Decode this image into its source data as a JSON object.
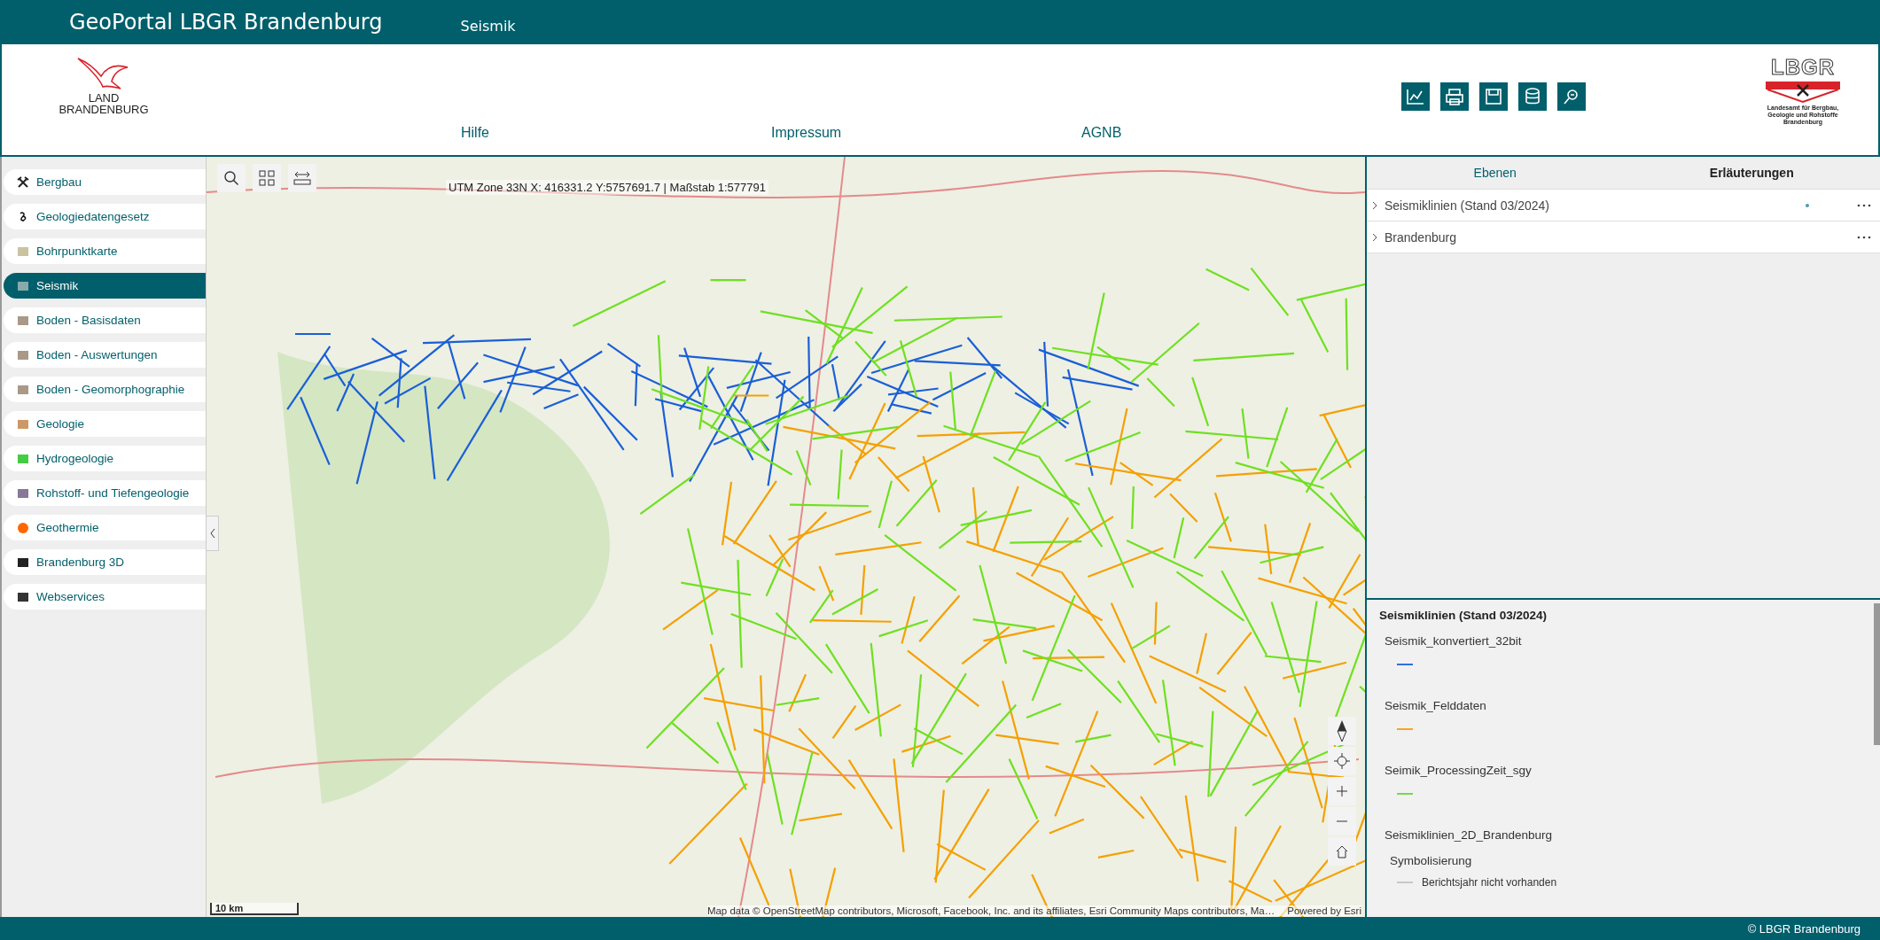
{
  "topbar": {
    "title": "GeoPortal LBGR Brandenburg",
    "section": "Seismik"
  },
  "header": {
    "state_logo": [
      "LAND",
      "BRANDENBURG"
    ],
    "nav": [
      "Hilfe",
      "Impressum",
      "AGNB"
    ],
    "agency_logo": {
      "acronym": "LBGR",
      "name": "Landesamt für Bergbau, Geologie und Rohstoffe Brandenburg"
    }
  },
  "sidebar": {
    "items": [
      {
        "label": "Bergbau",
        "selected": false
      },
      {
        "label": "Geologiedatengesetz",
        "selected": false
      },
      {
        "label": "Bohrpunktkarte",
        "selected": false
      },
      {
        "label": "Seismik",
        "selected": true
      },
      {
        "label": "Boden - Basisdaten",
        "selected": false
      },
      {
        "label": "Boden - Auswertungen",
        "selected": false
      },
      {
        "label": "Boden - Geomorphographie",
        "selected": false
      },
      {
        "label": "Geologie",
        "selected": false
      },
      {
        "label": "Hydrogeologie",
        "selected": false
      },
      {
        "label": "Rohstoff- und Tiefengeologie",
        "selected": false
      },
      {
        "label": "Geothermie",
        "selected": false
      },
      {
        "label": "Brandenburg 3D",
        "selected": false
      },
      {
        "label": "Webservices",
        "selected": false
      }
    ]
  },
  "map": {
    "coordinates": "UTM Zone 33N X: 416331.2 Y:5757691.7 | Maßstab 1:577791",
    "scale": "10 km",
    "attribution": "Map data © OpenStreetMap contributors, Microsoft, Facebook, Inc. and its affiliates, Esri Community Maps contributors, Ma…",
    "powered_by": "Powered by Esri"
  },
  "panel": {
    "tabs": [
      {
        "label": "Ebenen",
        "selected": false
      },
      {
        "label": "Erläuterungen",
        "selected": true
      }
    ],
    "layers": [
      {
        "name": "Seismiklinien (Stand 03/2024)",
        "indicator": true
      },
      {
        "name": "Brandenburg",
        "indicator": false
      }
    ],
    "legend": {
      "title": "Seismiklinien (Stand 03/2024)",
      "entries": [
        {
          "kind": "layer",
          "label": "Seismik_konvertiert_32bit",
          "color": "#2f6fe0"
        },
        {
          "kind": "layer",
          "label": "Seismik_Felddaten",
          "color": "#f5a623"
        },
        {
          "kind": "layer",
          "label": "Seimik_ProcessingZeit_sgy",
          "color": "#77d94a"
        },
        {
          "kind": "heading",
          "label": "Seismiklinien_2D_Brandenburg"
        },
        {
          "kind": "subheading",
          "label": "Symbolisierung"
        },
        {
          "kind": "class",
          "label": "Berichtsjahr nicht vorhanden",
          "color": "#c8c8c8"
        }
      ]
    }
  },
  "footer": {
    "copyright": "© LBGR Brandenburg"
  }
}
